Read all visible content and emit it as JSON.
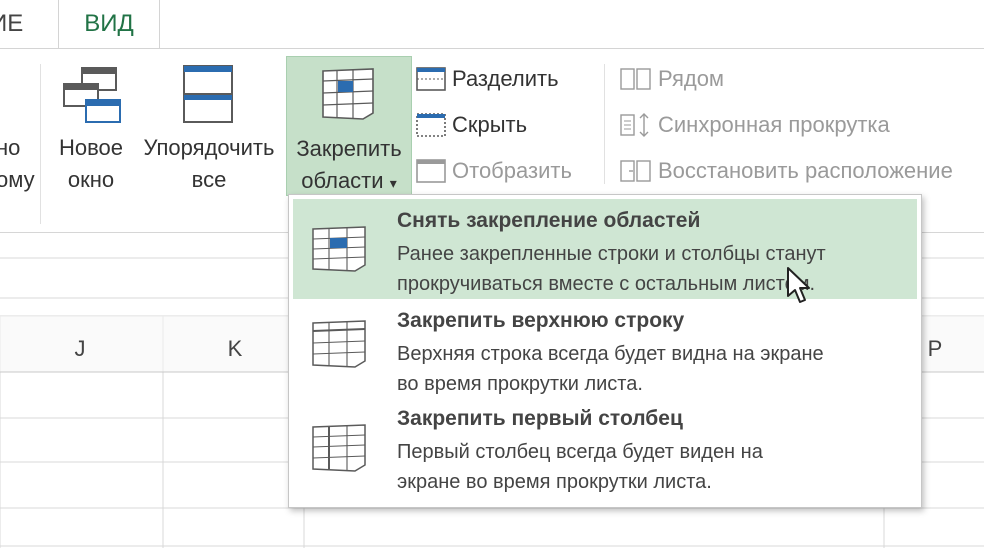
{
  "tabs": {
    "prev_fragment": "ИЕ",
    "active": "ВИД"
  },
  "ribbon": {
    "left_fragment_line1": "но",
    "left_fragment_line2": "ому",
    "new_window_line1": "Новое",
    "new_window_line2": "окно",
    "arrange_line1": "Упорядочить",
    "arrange_line2": "все",
    "freeze_line1": "Закрепить",
    "freeze_line2": "области",
    "freeze_arrow": "▾",
    "split": "Разделить",
    "hide": "Скрыть",
    "unhide": "Отобразить",
    "side_by_side": "Рядом",
    "sync_scroll": "Синхронная прокрутка",
    "reset_position": "Восстановить расположение"
  },
  "columns": [
    "J",
    "K",
    "P"
  ],
  "menu": {
    "items": [
      {
        "title": "Снять закрепление областей",
        "desc_line1": "Ранее закрепленные строки и столбцы станут",
        "desc_line2": "прокручиваться вместе с остальным листом."
      },
      {
        "title": "Закрепить верхнюю строку",
        "desc_line1": "Верхняя строка всегда будет видна на экране",
        "desc_line2": "во время прокрутки листа."
      },
      {
        "title": "Закрепить первый столбец",
        "desc_line1": "Первый столбец всегда будет виден на",
        "desc_line2": "экране во время прокрутки листа."
      }
    ]
  },
  "colors": {
    "accent": "#217346",
    "highlight": "#cfe6d3",
    "freeze_button": "#c6e0c9"
  }
}
